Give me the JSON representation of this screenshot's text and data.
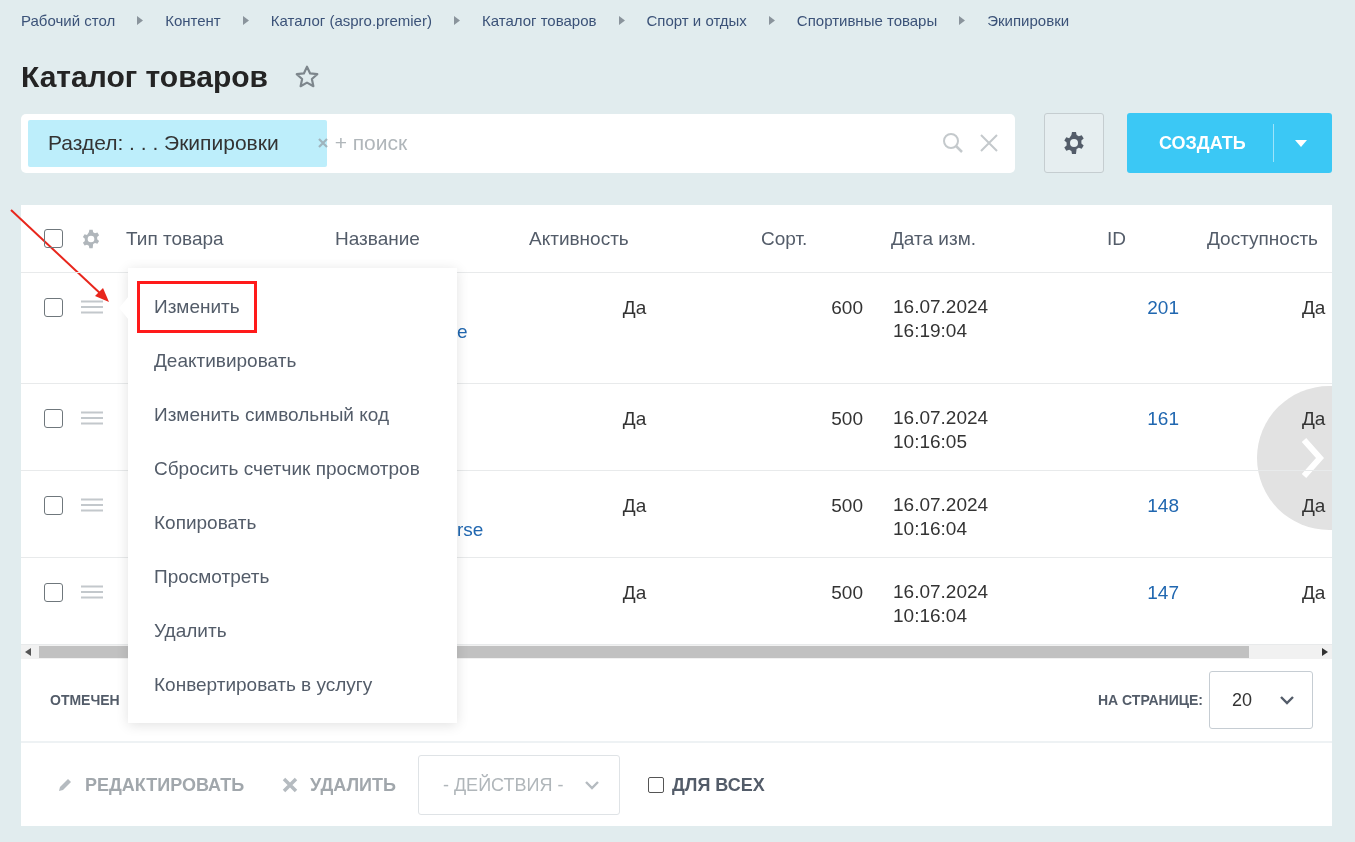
{
  "breadcrumbs": [
    "Рабочий стол",
    "Контент",
    "Каталог (aspro.premier)",
    "Каталог товаров",
    "Спорт и отдых",
    "Спортивные товары",
    "Экипировки"
  ],
  "title": "Каталог товаров",
  "filter": {
    "tag": "Раздел: . . . Экипировки",
    "placeholder": "+ поиск"
  },
  "create_button": "СОЗДАТЬ",
  "table": {
    "header_checked": false,
    "columns": [
      "Тип товара",
      "Название",
      "Активность",
      "Сорт.",
      "Дата изм.",
      "ID",
      "Доступность"
    ],
    "rows": [
      {
        "checked": false,
        "name": "e",
        "active": "Да",
        "sort": "600",
        "date": "16.07.2024",
        "time": "16:19:04",
        "id": "201",
        "available": "Да"
      },
      {
        "checked": false,
        "name": "",
        "active": "Да",
        "sort": "500",
        "date": "16.07.2024",
        "time": "10:16:05",
        "id": "161",
        "available": "Да"
      },
      {
        "checked": false,
        "name": "rse",
        "active": "Да",
        "sort": "500",
        "date": "16.07.2024",
        "time": "10:16:04",
        "id": "148",
        "available": "Да"
      },
      {
        "checked": false,
        "name": "",
        "active": "Да",
        "sort": "500",
        "date": "16.07.2024",
        "time": "10:16:04",
        "id": "147",
        "available": "Да"
      }
    ]
  },
  "context_menu": [
    {
      "label": "Изменить",
      "highlighted": true
    },
    {
      "label": "Деактивировать",
      "highlighted": false
    },
    {
      "label": "Изменить символьный код",
      "highlighted": false
    },
    {
      "label": "Сбросить счетчик просмотров",
      "highlighted": false
    },
    {
      "label": "Копировать",
      "highlighted": false
    },
    {
      "label": "Просмотреть",
      "highlighted": false
    },
    {
      "label": "Удалить",
      "highlighted": false
    },
    {
      "label": "Конвертировать в услугу",
      "highlighted": false
    }
  ],
  "footer": {
    "selected_label": "ОТМЕЧЕН",
    "per_page_label": "НА СТРАНИЦЕ:",
    "per_page": "20"
  },
  "actions": {
    "edit": "РЕДАКТИРОВАТЬ",
    "delete": "УДАЛИТЬ",
    "dropdown": "- ДЕЙСТВИЯ -",
    "for_all": "ДЛЯ ВСЕХ",
    "for_all_checked": false
  }
}
